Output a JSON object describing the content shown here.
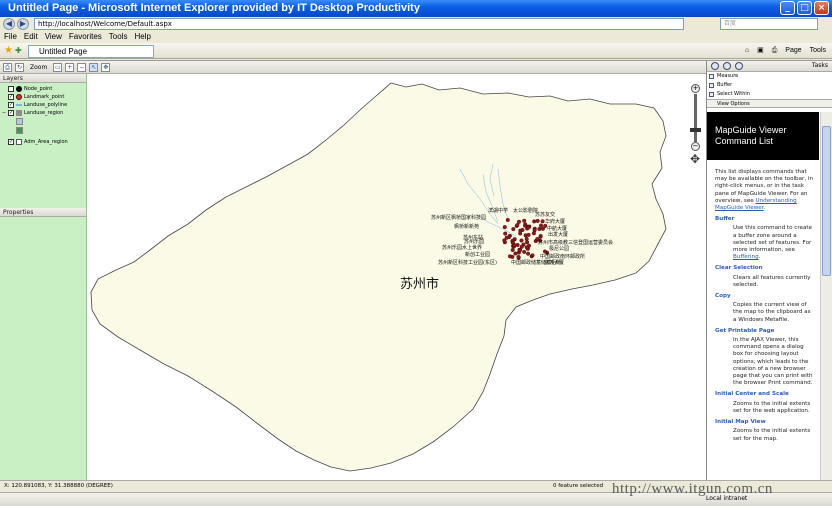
{
  "window": {
    "title": "Untitled Page - Microsoft Internet Explorer provided by IT Desktop Productivity"
  },
  "address": {
    "url": "http://localhost/Welcome/Default.aspx",
    "search_placeholder": "百度"
  },
  "menu": [
    "File",
    "Edit",
    "View",
    "Favorites",
    "Tools",
    "Help"
  ],
  "tab": {
    "label": "Untitled Page"
  },
  "browser_tools": {
    "page": "Page",
    "tools": "Tools"
  },
  "toolbar": {
    "zoom_label": "Zoom"
  },
  "layers_panel": {
    "header": "Layers",
    "items": [
      {
        "label": "Node_point",
        "checked": false,
        "swatch": "#000000"
      },
      {
        "label": "Landmark_point",
        "checked": true,
        "swatch": "#c0392b"
      },
      {
        "label": "Landuse_polyline",
        "checked": true,
        "swatch": "#7fb3e8"
      },
      {
        "label": "Landuse_region",
        "checked": true,
        "swatch": "#8e8e8e"
      },
      {
        "label": "Adm_Area_region",
        "checked": true,
        "swatch": "#ffffff"
      }
    ]
  },
  "properties_panel": {
    "header": "Properties"
  },
  "map": {
    "region_label": "苏州市",
    "region_fill": "#fafae6",
    "point_color": "#8b1a1a",
    "poi_labels": [
      "滨湖中学",
      "苏州新区枫桥国家科技园",
      "枫桥新新苑",
      "苏州东站",
      "苏州乐园",
      "苏州乐园水上世界",
      "新创工业园",
      "苏州新区科技工业园(东区)",
      "太公影剧院",
      "苏苏友交",
      "华府大厦",
      "中航大厦",
      "出发大厦",
      "苏州市高级教三信登国运营委员会",
      "极尼公园",
      "中国邮政南环邮政所",
      "京苏大厦",
      "中国邮政储蓄储蓄柜所"
    ]
  },
  "tasks_pane": {
    "tasks_label": "Tasks",
    "items": [
      "Measure",
      "Buffer",
      "Select Within"
    ],
    "view_options": "View Options",
    "header": "MapGuide Viewer Command List",
    "intro": "This list displays commands that may be available on the toolbar, in right-click menus, or in the task pane of MapGuide Viewer. For an overview, see",
    "intro_link": "Understanding MapGuide Viewer",
    "commands": [
      {
        "name": "Buffer",
        "desc": "Use this command to create a buffer zone around a selected set of features. For more information, see",
        "link": "Buffering"
      },
      {
        "name": "Clear Selection",
        "desc": "Clears all features currently selected.",
        "link": ""
      },
      {
        "name": "Copy",
        "desc": "Copies the current view of the map to the clipboard as a Windows Metafile.",
        "link": ""
      },
      {
        "name": "Get Printable Page",
        "desc": "In the AJAX Viewer, this command opens a dialog box for choosing layout options, which leads to the creation of a new browser page that you can print with the browser Print command.",
        "link": ""
      },
      {
        "name": "Initial Center and Scale",
        "desc": "Zooms to the initial extents set for the web application.",
        "link": ""
      },
      {
        "name": "Initial Map View",
        "desc": "Zooms to the initial extents set for the map.",
        "link": ""
      }
    ]
  },
  "status": {
    "coords": "X: 120.891083, Y: 31.388880 (DEGREE)",
    "selection": "0 feature selected"
  },
  "ie_status": {
    "zone": "Local intranet"
  },
  "watermark": "http://www.itgun.com.cn"
}
